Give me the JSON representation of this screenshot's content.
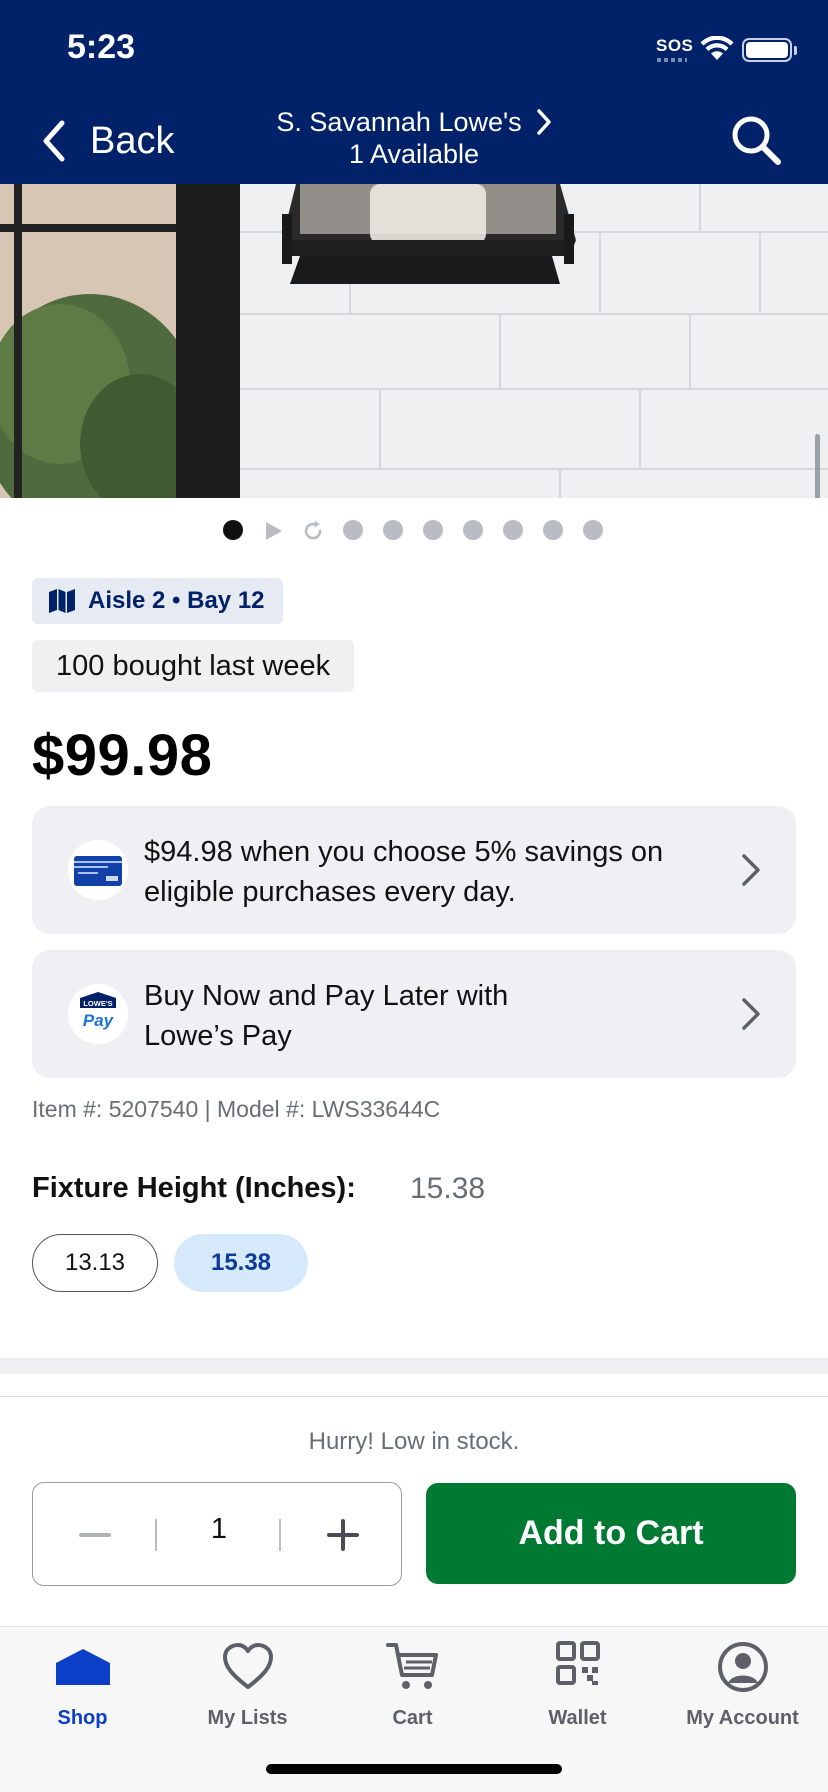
{
  "status_bar": {
    "time": "5:23",
    "sos": "SOS"
  },
  "header": {
    "back_label": "Back",
    "store_name": "S. Savannah Lowe's",
    "availability": "1 Available"
  },
  "product": {
    "aisle": "Aisle 2 • Bay 12",
    "bought": "100 bought last week",
    "price": "$99.98",
    "item_model": "Item #: 5207540 | Model #: LWS33644C",
    "carousel": {
      "total": 10,
      "active_index": 0
    }
  },
  "promos": [
    {
      "text": "$94.98 when you choose 5% savings on eligible purchases every day.",
      "badge": "card-icon"
    },
    {
      "text": "Buy Now and Pay Later with Lowe’s Pay",
      "badge": "lowes-pay-icon"
    }
  ],
  "lowes_pay_logo": {
    "top": "LOWE'S",
    "bottom": "Pay"
  },
  "fixture": {
    "label": "Fixture Height (Inches):",
    "selected_value": "15.38",
    "options": [
      "13.13",
      "15.38"
    ],
    "selected_index": 1
  },
  "cart": {
    "stock_message": "Hurry! Low in stock.",
    "quantity": "1",
    "add_label": "Add to Cart"
  },
  "tabs": [
    {
      "label": "Shop",
      "icon": "shop-icon",
      "active": true
    },
    {
      "label": "My Lists",
      "icon": "heart-icon",
      "active": false
    },
    {
      "label": "Cart",
      "icon": "cart-icon",
      "active": false
    },
    {
      "label": "Wallet",
      "icon": "qr-code-icon",
      "active": false
    },
    {
      "label": "My Account",
      "icon": "account-icon",
      "active": false
    }
  ],
  "colors": {
    "header_bg": "#012169",
    "add_to_cart": "#007a33",
    "active_tab": "#0b3fc8",
    "selected_chip_bg": "#d6e9fb"
  }
}
